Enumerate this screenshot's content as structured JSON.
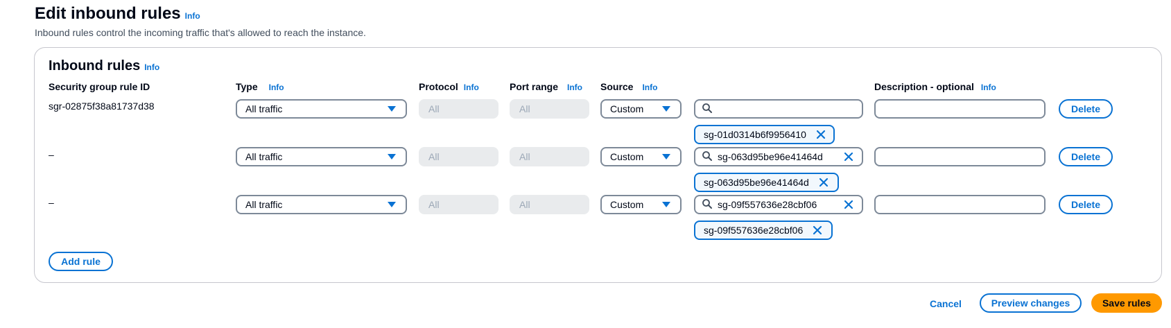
{
  "page": {
    "title": "Edit inbound rules",
    "title_info": "Info",
    "subtitle": "Inbound rules control the incoming traffic that's allowed to reach the instance."
  },
  "panel": {
    "title": "Inbound rules",
    "title_info": "Info",
    "columns": {
      "rule_id": "Security group rule ID",
      "type": "Type",
      "protocol": "Protocol",
      "port_range": "Port range",
      "source": "Source",
      "description": "Description - optional",
      "info": "Info"
    },
    "rows": [
      {
        "rule_id": "sgr-02875f38a81737d38",
        "type": "All traffic",
        "protocol": "All",
        "port_range": "All",
        "source": "Custom",
        "search_value": "",
        "token": "sg-01d0314b6f9956410",
        "description": "",
        "delete": "Delete"
      },
      {
        "rule_id": "–",
        "type": "All traffic",
        "protocol": "All",
        "port_range": "All",
        "source": "Custom",
        "search_value": "sg-063d95be96e41464d",
        "token": "sg-063d95be96e41464d",
        "description": "",
        "delete": "Delete"
      },
      {
        "rule_id": "–",
        "type": "All traffic",
        "protocol": "All",
        "port_range": "All",
        "source": "Custom",
        "search_value": "sg-09f557636e28cbf06",
        "token": "sg-09f557636e28cbf06",
        "description": "",
        "delete": "Delete"
      }
    ],
    "add_rule": "Add rule"
  },
  "footer": {
    "cancel": "Cancel",
    "preview": "Preview changes",
    "save": "Save rules"
  },
  "colors": {
    "link_blue": "#0972d3",
    "primary_orange": "#ff9900",
    "border_gray": "#7d8998"
  },
  "icons": [
    "search-icon",
    "dismiss-icon",
    "caret-down-icon"
  ]
}
